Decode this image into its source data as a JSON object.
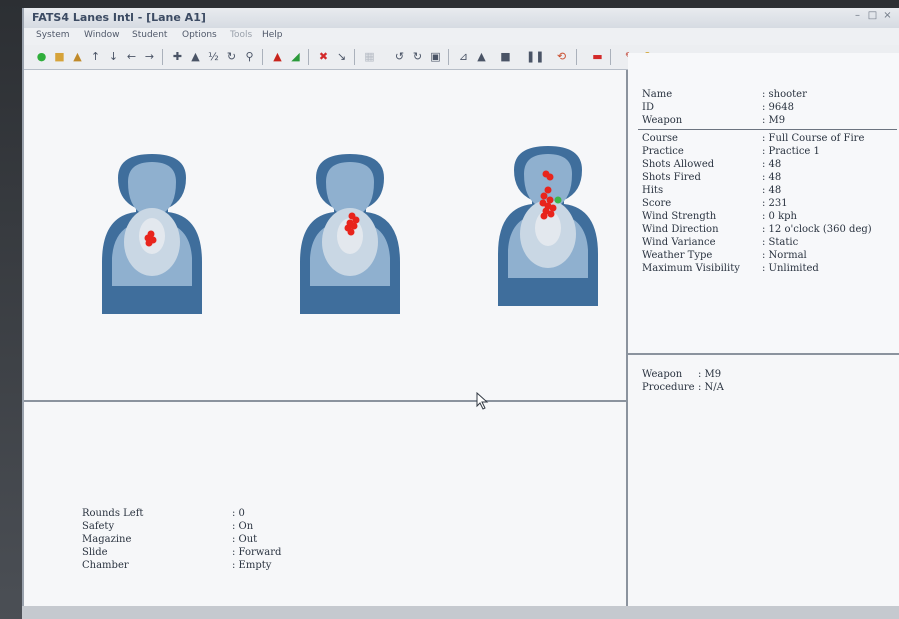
{
  "window": {
    "title": "FATS4 Lanes Intl - [Lane A1]",
    "controls": {
      "minimize": "–",
      "maximize": "□",
      "close": "×"
    }
  },
  "menu": [
    "System",
    "Window",
    "Student",
    "Options",
    "Tools",
    "Help"
  ],
  "toolbar_icons": [
    "green-circle-icon",
    "folder-icon",
    "lock-icon",
    "arrow-up-icon",
    "arrow-down-icon",
    "arrow-left-icon",
    "arrow-right-icon",
    "target-add-icon",
    "shooter-icon",
    "half-icon",
    "rotate-icon",
    "zoom-icon",
    "red-lock-icon",
    "green-lock-icon",
    "stop-icon",
    "arrow-icon",
    "grid-icon",
    "cycle-left-icon",
    "cycle-right-icon",
    "monitor-icon",
    "chart-icon",
    "person-icon",
    "panel-icon",
    "pause-icon",
    "restart-icon",
    "exit-icon",
    "info-icon",
    "help-icon"
  ],
  "shooter_info": {
    "name": {
      "label": "Name",
      "value": ": shooter"
    },
    "id": {
      "label": "ID",
      "value": ": 9648"
    },
    "weapon": {
      "label": "Weapon",
      "value": ": M9"
    }
  },
  "session_info": [
    {
      "label": "Course",
      "value": ": Full Course of Fire"
    },
    {
      "label": "Practice",
      "value": ": Practice 1"
    },
    {
      "label": "Shots Allowed",
      "value": ": 48"
    },
    {
      "label": "Shots Fired",
      "value": ": 48"
    },
    {
      "label": "Hits",
      "value": ": 48"
    },
    {
      "label": "Score",
      "value": ": 231"
    },
    {
      "label": "Wind Strength",
      "value": ": 0 kph"
    },
    {
      "label": "Wind Direction",
      "value": ": 12 o'clock (360 deg)"
    },
    {
      "label": "Wind Variance",
      "value": ": Static"
    },
    {
      "label": "Weather Type",
      "value": ": Normal"
    },
    {
      "label": "Maximum Visibility",
      "value": ": Unlimited"
    }
  ],
  "weapon_panel": {
    "weapon": {
      "label": "Weapon",
      "value": ": M9"
    },
    "procedure": {
      "label": "Procedure",
      "value": ": N/A"
    }
  },
  "weapon_state": [
    {
      "label": "Rounds Left",
      "value": ": 0"
    },
    {
      "label": "Safety",
      "value": ": On"
    },
    {
      "label": "Magazine",
      "value": ": Out"
    },
    {
      "label": "Slide",
      "value": ": Forward"
    },
    {
      "label": "Chamber",
      "value": ": Empty"
    }
  ],
  "colors": {
    "target_outer": "#3f6e9c",
    "target_mid": "#8fb0cf",
    "target_inner": "#c9d7e4",
    "target_center": "#e3e8ee",
    "hit_red": "#e8241c",
    "hit_green": "#3fb54a"
  }
}
